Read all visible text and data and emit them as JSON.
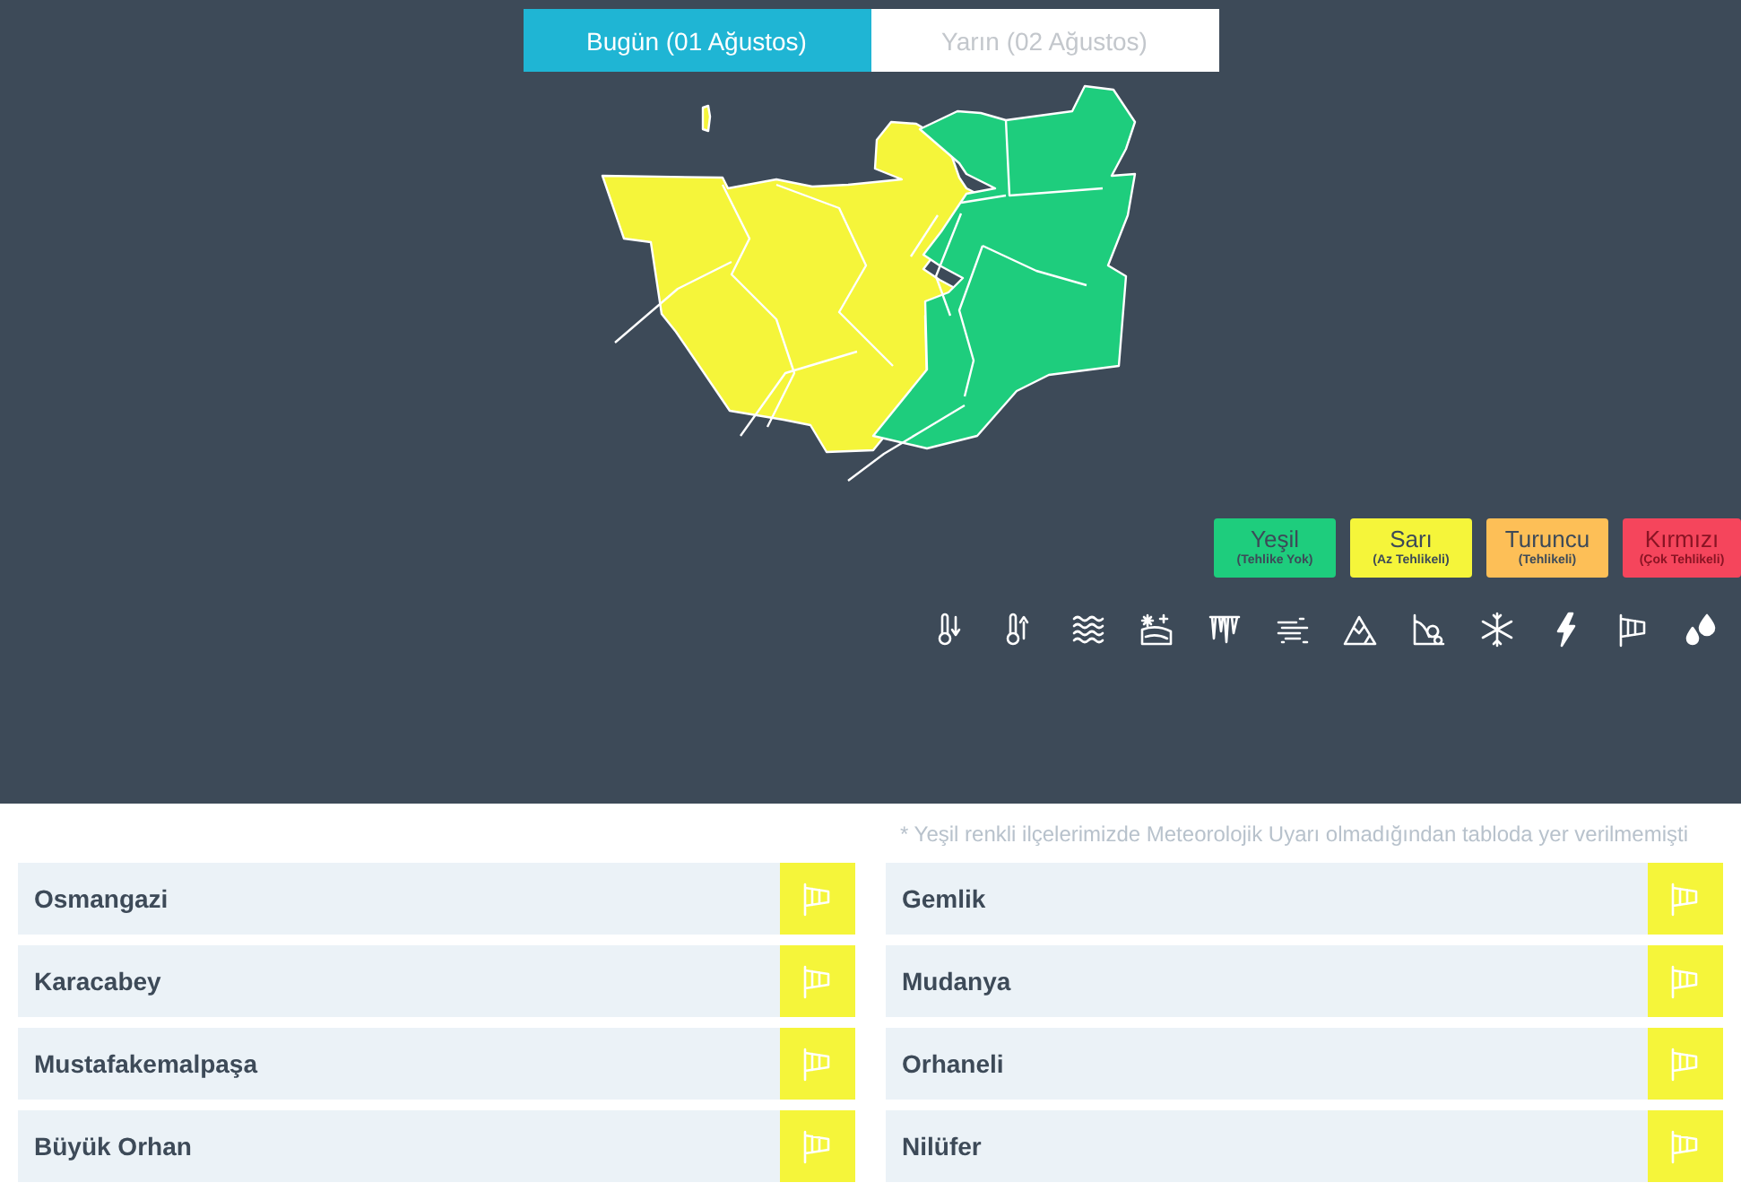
{
  "tabs": [
    {
      "label": "Bugün (01 Ağustos)",
      "selected": true
    },
    {
      "label": "Yarın (02 Ağustos)",
      "selected": false
    }
  ],
  "legend": [
    {
      "label": "Yeşil",
      "sublabel": "(Tehlike Yok)",
      "color": "#1ecd7d"
    },
    {
      "label": "Sarı",
      "sublabel": "(Az Tehlikeli)",
      "color": "#f5f53a"
    },
    {
      "label": "Turuncu",
      "sublabel": "(Tehlikeli)",
      "color": "#fdbf57"
    },
    {
      "label": "Kırmızı",
      "sublabel": "(Çok Tehlikeli)",
      "color": "#f5455c"
    }
  ],
  "note": "* Yeşil renkli ilçelerimizde Meteorolojik Uyarı olmadığından tabloda yer verilmemişti",
  "districts": [
    {
      "name": "Osmangazi",
      "color": "#f5f53a"
    },
    {
      "name": "Gemlik",
      "color": "#f5f53a"
    },
    {
      "name": "Karacabey",
      "color": "#f5f53a"
    },
    {
      "name": "Mudanya",
      "color": "#f5f53a"
    },
    {
      "name": "Mustafakemalpaşa",
      "color": "#f5f53a"
    },
    {
      "name": "Orhaneli",
      "color": "#f5f53a"
    },
    {
      "name": "Büyük Orhan",
      "color": "#f5f53a"
    },
    {
      "name": "Nilüfer",
      "color": "#f5f53a"
    }
  ]
}
